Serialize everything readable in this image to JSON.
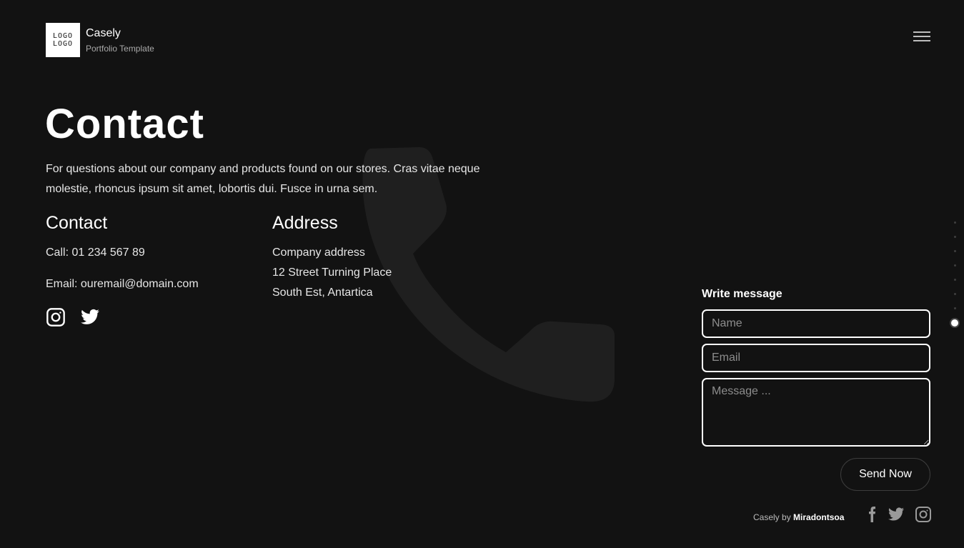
{
  "brand": {
    "logo_text_1": "LOGO",
    "logo_text_2": "LOGO",
    "name": "Casely",
    "tagline": "Portfolio Template"
  },
  "header": {
    "menu_icon": "hamburger-icon"
  },
  "page": {
    "title": "Contact",
    "intro": "For questions about our company and products found on our stores. Cras vitae neque molestie, rhoncus ipsum sit amet, lobortis dui. Fusce in urna sem."
  },
  "contact": {
    "heading": "Contact",
    "call": "Call: 01 234 567 89",
    "email": "Email: ouremail@domain.com",
    "social_icons": [
      "instagram-icon",
      "twitter-icon"
    ]
  },
  "address": {
    "heading": "Address",
    "line1": "Company address",
    "line2": "12 Street Turning Place",
    "line3": "South Est, Antartica"
  },
  "form": {
    "title": "Write message",
    "name_placeholder": "Name",
    "email_placeholder": "Email",
    "message_placeholder": "Message ...",
    "send_label": "Send Now"
  },
  "footer": {
    "credit_prefix": "Casely by",
    "credit_author": "Miradontsoa",
    "icons": [
      "facebook-icon",
      "twitter-icon",
      "instagram-icon"
    ]
  },
  "section_nav": {
    "count": 8,
    "active_index": 7
  },
  "colors": {
    "background": "#121212",
    "text": "#ffffff",
    "muted": "#a9a9a9"
  }
}
